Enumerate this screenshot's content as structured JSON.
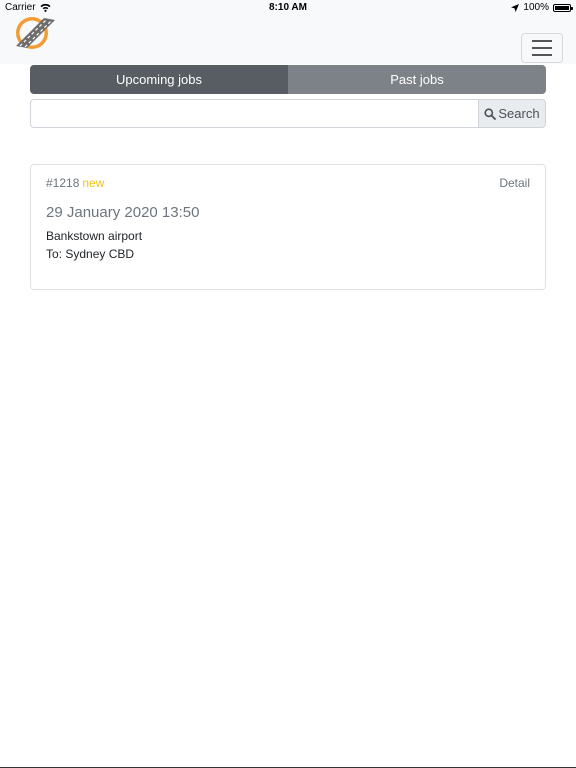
{
  "status_bar": {
    "carrier": "Carrier",
    "time": "8:10 AM",
    "battery": "100%",
    "battery_level": 1.0
  },
  "navbar": {
    "logo_icon": "road-logo-icon",
    "menu_icon": "hamburger-menu-icon"
  },
  "tabs": [
    {
      "label": "Upcoming jobs",
      "active": true
    },
    {
      "label": "Past jobs",
      "active": false
    }
  ],
  "search": {
    "value": "",
    "placeholder": "",
    "button_label": "Search",
    "icon": "search-icon"
  },
  "jobs": [
    {
      "id": "#1218",
      "badge": "new",
      "detail_label": "Detail",
      "datetime": "29 January 2020 13:50",
      "from": "Bankstown airport",
      "to": "To: Sydney CBD"
    }
  ],
  "colors": {
    "tab_active": "#575d63",
    "tab_inactive": "#7c8287",
    "badge_new": "#f1c40f",
    "logo_orange": "#f39c36"
  }
}
